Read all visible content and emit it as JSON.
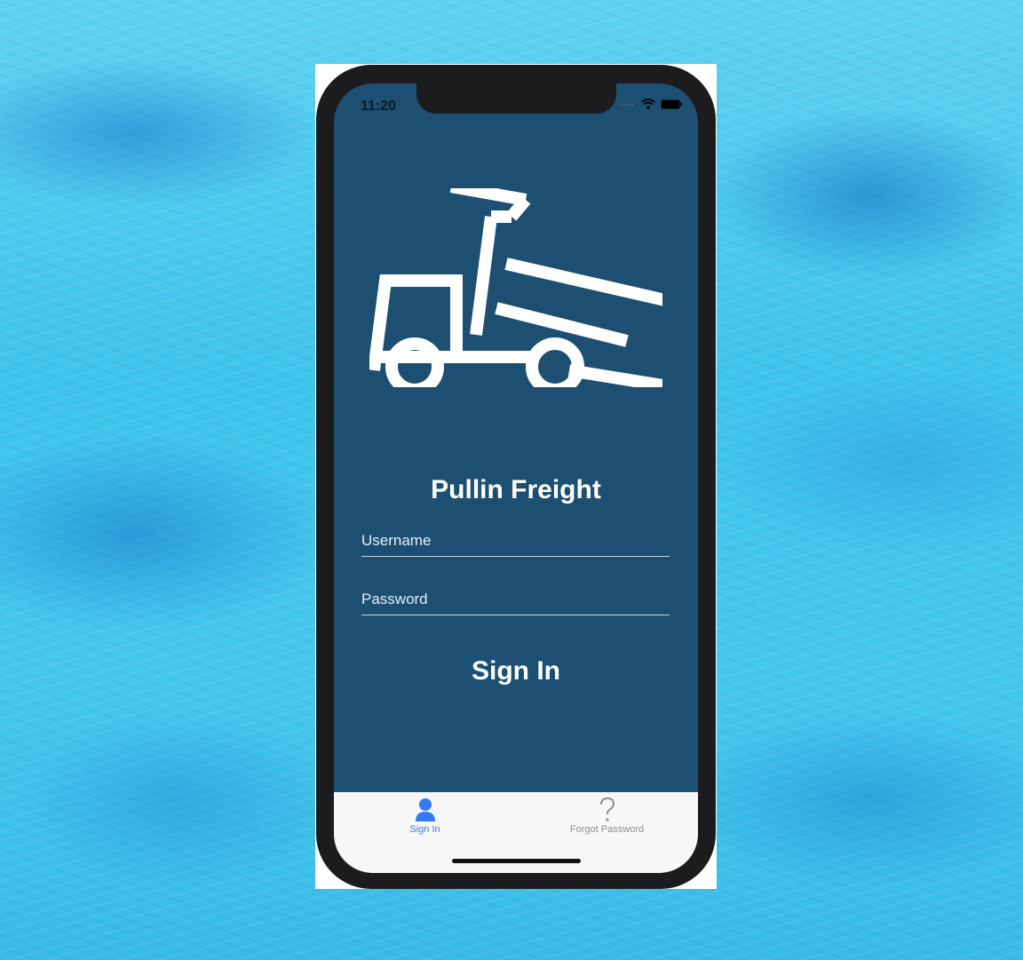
{
  "status_bar": {
    "time": "11:20",
    "icons": [
      "signal-icon",
      "wifi-icon",
      "battery-icon"
    ]
  },
  "app": {
    "title": "Pullin Freight",
    "logo_icon": "dump-truck-icon"
  },
  "form": {
    "username_placeholder": "Username",
    "password_placeholder": "Password",
    "sign_in_label": "Sign In"
  },
  "tab_bar": {
    "tabs": [
      {
        "label": "Sign In",
        "icon": "person-icon",
        "active": true
      },
      {
        "label": "Forgot Password",
        "icon": "question-mark-icon",
        "active": false
      }
    ]
  },
  "colors": {
    "screen_background": "#1c4f72",
    "accent": "#3478f6",
    "tab_bar_background": "#f7f7f7",
    "water_background": "#45c8ee"
  }
}
